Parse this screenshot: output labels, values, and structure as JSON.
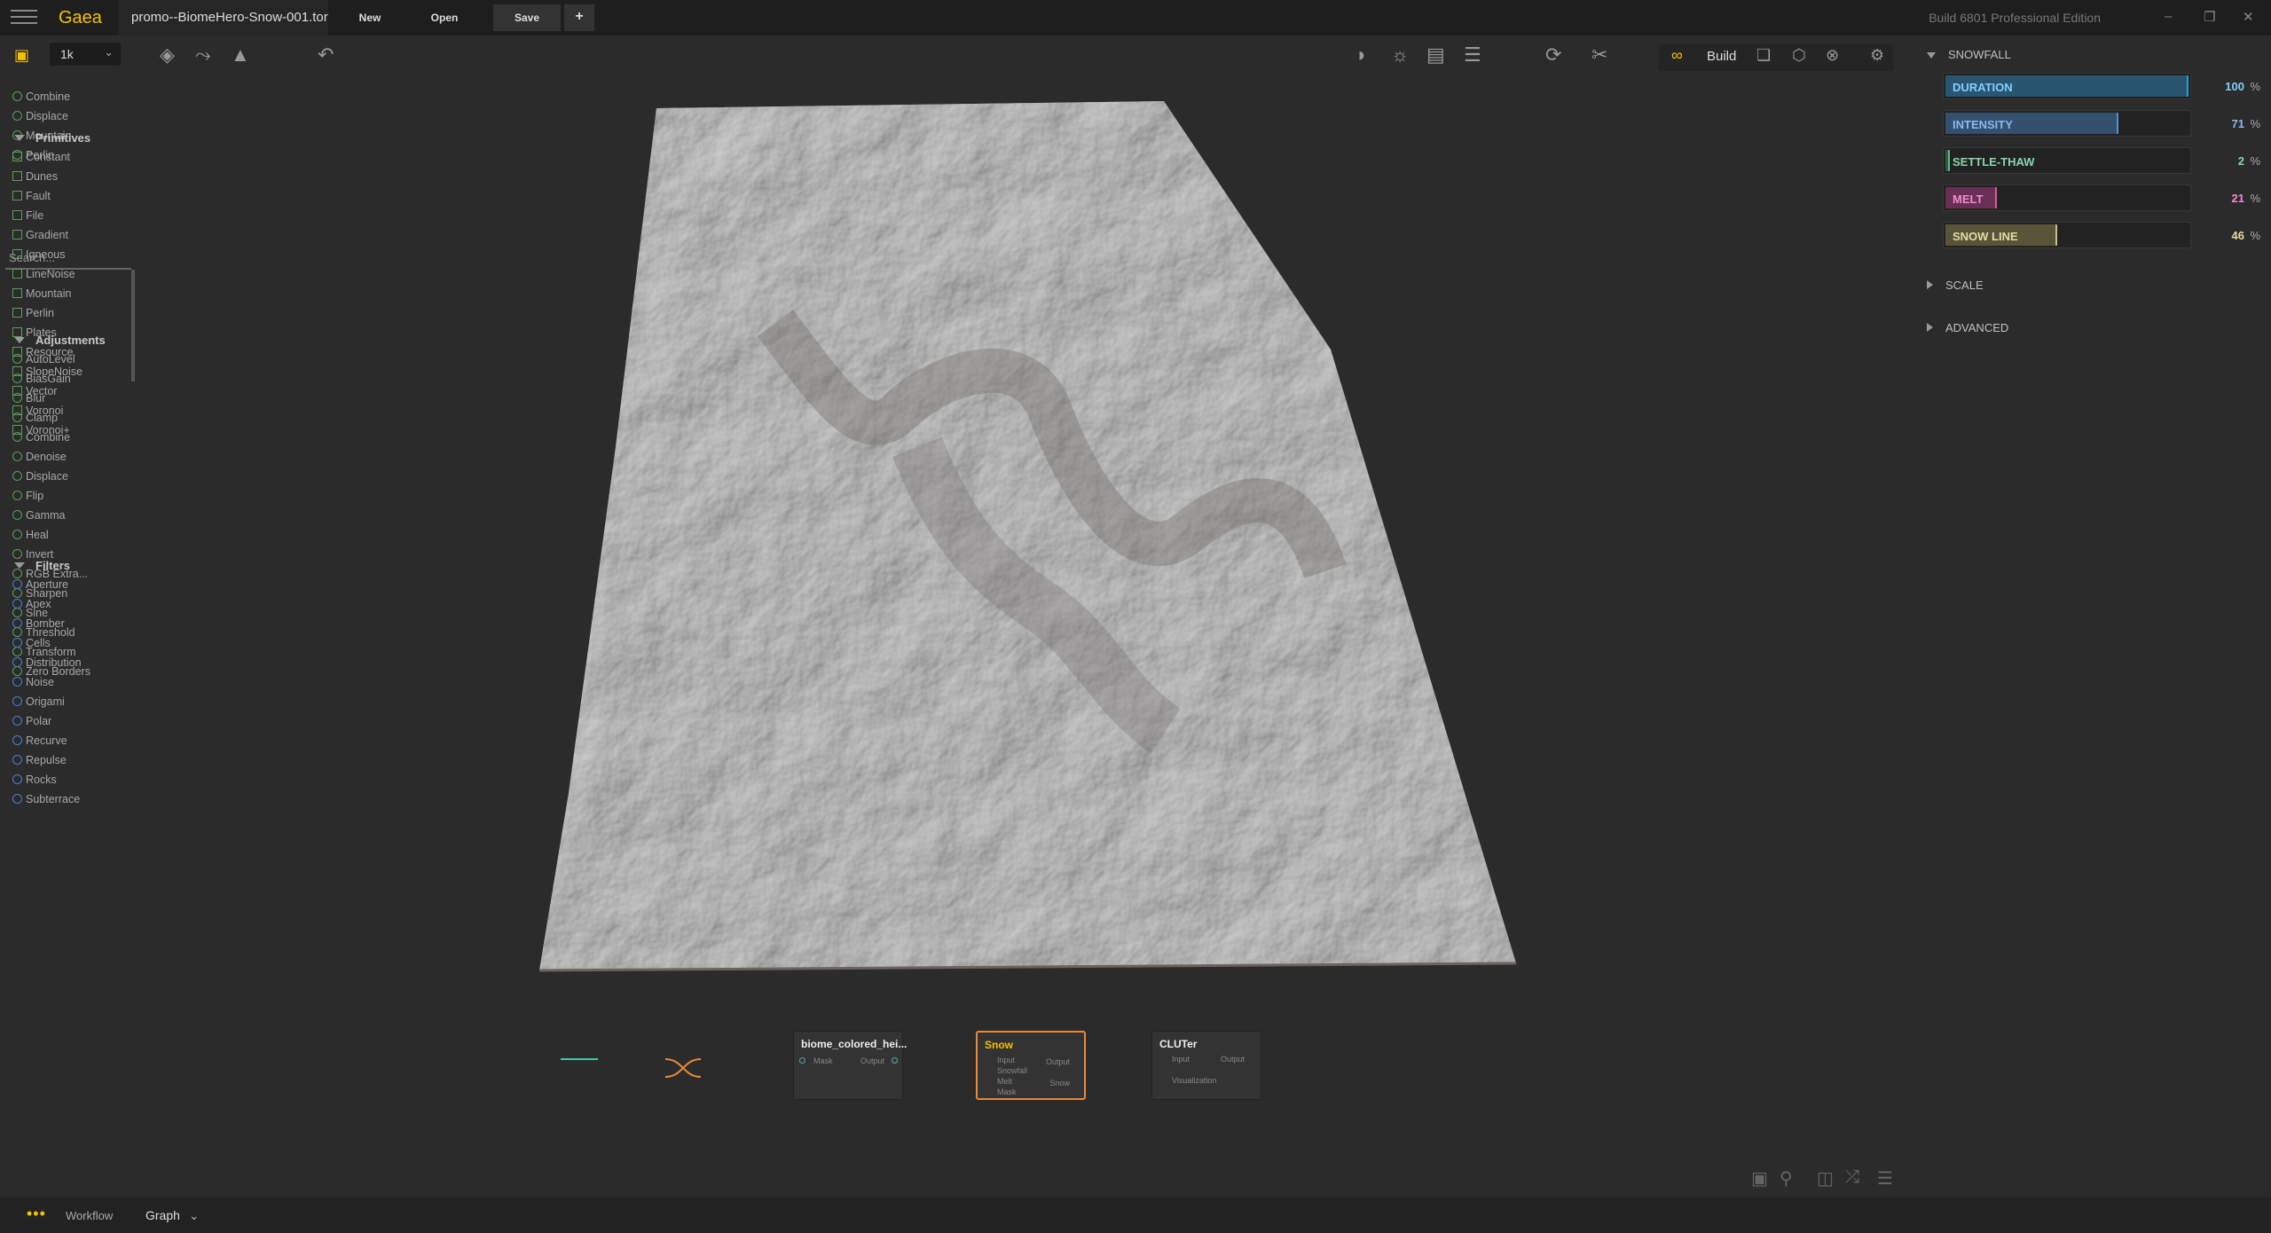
{
  "titlebar": {
    "app_name": "Gaea",
    "file_tab": "promo--BiomeHero-Snow-001.tor",
    "new_label": "New",
    "open_label": "Open",
    "save_label": "Save",
    "add_label": "+",
    "build_info": "Build 6801 Professional Edition"
  },
  "toolbar": {
    "resolution": "1k",
    "build_label": "Build"
  },
  "left_panel": {
    "recent": [
      "Combine",
      "Displace",
      "Mountain",
      "Perlin"
    ],
    "search_placeholder": "Search...",
    "sections": [
      {
        "title": "Primitives",
        "items": [
          "Constant",
          "Dunes",
          "Fault",
          "File",
          "Gradient",
          "Igneous",
          "LineNoise",
          "Mountain",
          "Perlin",
          "Plates",
          "Resource",
          "SlopeNoise",
          "Vector",
          "Voronoi",
          "Voronoi+"
        ]
      },
      {
        "title": "Adjustments",
        "items": [
          "AutoLevel",
          "BiasGain",
          "Blur",
          "Clamp",
          "Combine",
          "Denoise",
          "Displace",
          "Flip",
          "Gamma",
          "Heal",
          "Invert",
          "RGB Extra...",
          "Sharpen",
          "Sine",
          "Threshold",
          "Transform",
          "Zero Borders"
        ]
      },
      {
        "title": "Filters",
        "items": [
          "Aperture",
          "Apex",
          "Bomber",
          "Cells",
          "Distribution",
          "Noise",
          "Origami",
          "Polar",
          "Recurve",
          "Repulse",
          "Rocks",
          "Subterrace"
        ]
      }
    ]
  },
  "graph": {
    "nodes": [
      {
        "title": "biome_colored_hei...",
        "ports_in": [
          "Mask"
        ],
        "ports_out": [
          "Output"
        ]
      },
      {
        "title": "Snow",
        "ports_in": [
          "Input",
          "Snowfall",
          "Melt",
          "Mask"
        ],
        "ports_out": [
          "Output",
          "Snow"
        ]
      },
      {
        "title": "CLUTer",
        "ports_in": [
          "Input",
          "Visualization"
        ],
        "ports_out": [
          "Output"
        ]
      }
    ]
  },
  "right_panel": {
    "section_title": "SNOWFALL",
    "sliders": [
      {
        "label": "DURATION",
        "value": "100",
        "fraction": 1.0,
        "color": "#2f9bd6",
        "text_color": "#7fd0ff",
        "fill": "#2a5570"
      },
      {
        "label": "INTENSITY",
        "value": "71",
        "fraction": 0.71,
        "color": "#5a8fd0",
        "text_color": "#8cb7ef",
        "fill": "#34506f"
      },
      {
        "label": "SETTLE-THAW",
        "value": "2",
        "fraction": 0.02,
        "color": "#5ab88a",
        "text_color": "#8ad6ac",
        "fill": "#2f5a45"
      },
      {
        "label": "MELT",
        "value": "21",
        "fraction": 0.21,
        "color": "#d65aa8",
        "text_color": "#ef8ccb",
        "fill": "#6a2f55"
      },
      {
        "label": "SNOW LINE",
        "value": "46",
        "fraction": 0.46,
        "color": "#c9c07a",
        "text_color": "#e5dca3",
        "fill": "#57543a"
      }
    ],
    "pct_symbol": "%",
    "collapsed": [
      "SCALE",
      "ADVANCED"
    ]
  },
  "statusbar": {
    "dots": "•••",
    "workflow": "Workflow",
    "graph": "Graph"
  },
  "colors": {
    "accent": "#f2c200",
    "node_selected": "#e8893a",
    "wire": "#3fc9a6"
  }
}
